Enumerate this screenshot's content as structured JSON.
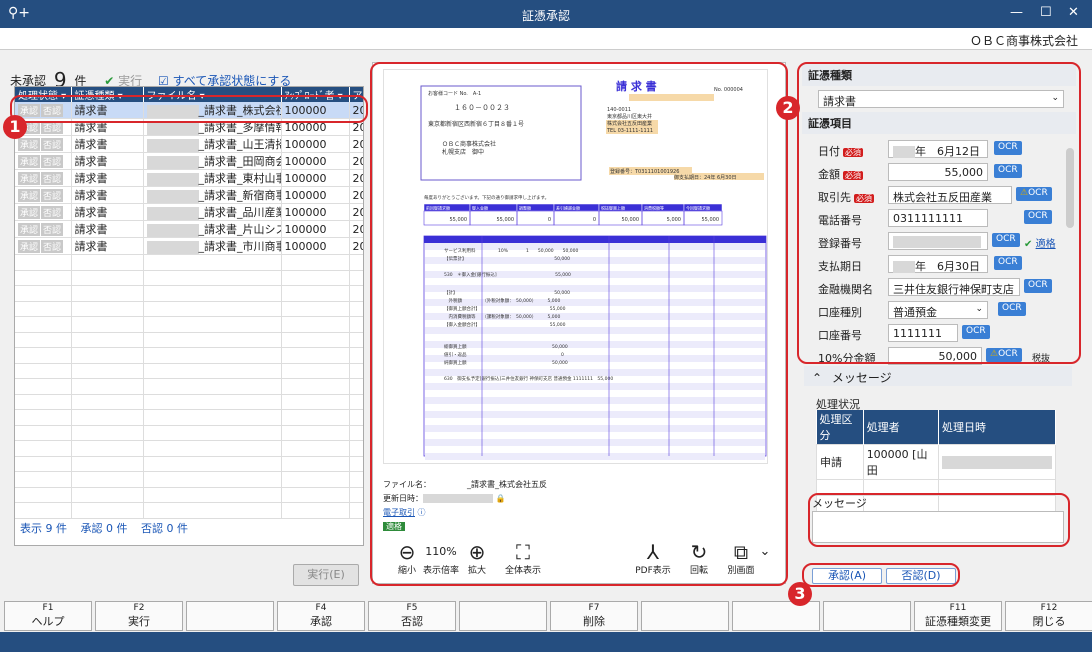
{
  "window": {
    "title": "証憑承認",
    "company": "ＯＢＣ商事株式会社",
    "minimize": "—",
    "maximize": "☐",
    "close": "✕"
  },
  "summary": {
    "label": "未承認",
    "count": "9",
    "unit": "件",
    "exec_label": "実行",
    "approve_all": "すべて承認状態にする"
  },
  "grid": {
    "headers": [
      "処理状態",
      "証憑種類",
      "ファイル名",
      "ｱｯﾌﾟﾛｰﾄﾞ者",
      "ア"
    ],
    "mini_approve": "承認",
    "mini_reject": "否認",
    "rows": [
      {
        "type": "請求書",
        "file": "_請求書_株式会社",
        "uploader": "100000",
        "col": "20"
      },
      {
        "type": "請求書",
        "file": "_請求書_多摩情報",
        "uploader": "100000",
        "col": "20"
      },
      {
        "type": "請求書",
        "file": "_請求書_山王清掃",
        "uploader": "100000",
        "col": "20"
      },
      {
        "type": "請求書",
        "file": "_請求書_田岡商会",
        "uploader": "100000",
        "col": "20"
      },
      {
        "type": "請求書",
        "file": "_請求書_東村山事",
        "uploader": "100000",
        "col": "20"
      },
      {
        "type": "請求書",
        "file": "_請求書_新宿商事",
        "uploader": "100000",
        "col": "20"
      },
      {
        "type": "請求書",
        "file": "_請求書_品川産業",
        "uploader": "100000",
        "col": "20"
      },
      {
        "type": "請求書",
        "file": "_請求書_片山シス",
        "uploader": "100000",
        "col": "20"
      },
      {
        "type": "請求書",
        "file": "_請求書_市川商事",
        "uploader": "100000",
        "col": "20"
      }
    ],
    "footer": {
      "display": "表示 9 件",
      "approved": "承認 0 件",
      "rejected": "否認 0 件"
    },
    "exec_button": "実行(E)"
  },
  "document": {
    "title": "請 求 書",
    "customer_code": "お客様コード No.　A-1",
    "postal": "１６０－００２３",
    "address": "東京都新宿区西新宿６丁目８番１号",
    "recipient": "ＯＢＣ商事株式会社",
    "branch": "札幌支店　御中",
    "issuer_no": "No. 000004",
    "issuer_postal": "140-0011",
    "issuer_addr": "東京都品川区東大井",
    "issuer_name": "株式会社五反田産業",
    "issuer_tel": "TEL 03-1111-1111",
    "reg_no": "登録番号：T0311101001926",
    "due": "御支払期日：24年 6月30日",
    "greeting": "毎度ありがとうございます。下記の通り御請求申し上げます。",
    "headers": [
      "前回御請求額",
      "御入金額",
      "調整額",
      "差引繰越金額",
      "税抜御買上額",
      "消費税額等",
      "今回御請求額"
    ],
    "values": [
      "55,000",
      "55,000",
      "0",
      "0",
      "50,000",
      "5,000",
      "55,000"
    ],
    "lines": [
      "サービス利用料　　　　　10%　　　　1　　50,000　　50,000",
      "【伝票計】　　　　　　　　　　　　　　　　　　　　50,000",
      "530　＊御入金[銀行振込]　　　　　　　　　　　　　55,000",
      "【計】　　　　　　　　　　　　　　　　　　　　　　50,000",
      "　外税額　　　　　（外税対象額：　50,000）　　　5,000",
      "【御買上額合計】　　　　　　　　　　　　　　　　55,000",
      "　内消費税額等　　（課税対象額：　50,000）　　　5,000",
      "【御入金額合計】　　　　　　　　　　　　　　　　55,000",
      "総御買上額　　　　　　　　　　　　　　　　　　　50,000",
      "値引・返品　　　　　　　　　　　　　　　　　　　　　0",
      "純御買上額　　　　　　　　　　　　　　　　　　　50,000",
      "630　御支払予定[銀行振込]三井住友銀行 神保町支店 普通預金 1111111　55,000"
    ]
  },
  "fileinfo": {
    "filename": "ファイル名：　　　　　_請求書_株式会社五反",
    "updated": "更新日時：",
    "e_trade": "電子取引",
    "status": "適格"
  },
  "viewer": {
    "zoom_out": "縮小",
    "zoom": "110%",
    "zoom_label": "表示倍率",
    "zoom_in": "拡大",
    "fit": "全体表示",
    "pdf": "PDF表示",
    "rotate": "回転",
    "separate": "別画面"
  },
  "right": {
    "type_section": "証憑種類",
    "type_value": "請求書",
    "items_section": "証憑項目",
    "required": "必須",
    "ocr": "OCR",
    "fields": {
      "date": {
        "label": "日付",
        "value": "年　6月12日"
      },
      "amount": {
        "label": "金額",
        "value": "55,000"
      },
      "partner": {
        "label": "取引先",
        "value": "株式会社五反田産業"
      },
      "phone": {
        "label": "電話番号",
        "value": "0311111111"
      },
      "regno": {
        "label": "登録番号",
        "value": "",
        "check": "適格"
      },
      "due": {
        "label": "支払期日",
        "value": "年　6月30日"
      },
      "bank": {
        "label": "金融機関名",
        "value": "三井住友銀行神保町支店"
      },
      "acct_type": {
        "label": "口座種別",
        "value": "普通預金"
      },
      "acct_no": {
        "label": "口座番号",
        "value": "1111111"
      },
      "tax10": {
        "label": "10%分金額",
        "value": "50,000",
        "extra": "税抜"
      }
    },
    "message_bar": "メッセージ",
    "process_label": "処理状況",
    "process_headers": [
      "処理区分",
      "処理者",
      "処理日時"
    ],
    "process_row": [
      "申請",
      "100000 [山田",
      ""
    ],
    "message_label": "メッセージ",
    "approve_btn": "承認(A)",
    "reject_btn": "否認(D)"
  },
  "fkeys": [
    {
      "key": "F1",
      "label": "ヘルプ"
    },
    {
      "key": "F2",
      "label": "実行"
    },
    {
      "key": "",
      "label": ""
    },
    {
      "key": "F4",
      "label": "承認"
    },
    {
      "key": "F5",
      "label": "否認"
    },
    {
      "key": "",
      "label": ""
    },
    {
      "key": "F7",
      "label": "削除"
    },
    {
      "key": "",
      "label": ""
    },
    {
      "key": "",
      "label": ""
    },
    {
      "key": "",
      "label": ""
    },
    {
      "key": "F11",
      "label": "証憑種類変更"
    },
    {
      "key": "F12",
      "label": "閉じる"
    }
  ],
  "annotations": [
    "1",
    "2",
    "3"
  ]
}
